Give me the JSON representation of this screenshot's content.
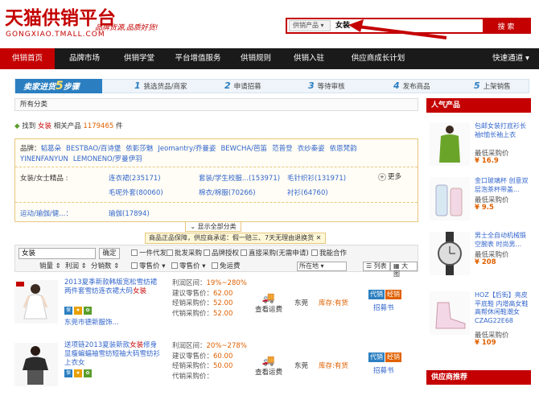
{
  "header": {
    "logo": "天猫供销平台",
    "logo_sub": "GONGXIAO.TMALL.COM",
    "slogan": "品牌货源,品质好货!"
  },
  "search": {
    "category": "供销产品 ▾",
    "keyword": "女装",
    "button": "搜 索"
  },
  "nav": {
    "items": [
      "供销首页",
      "品牌市场",
      "供销学堂",
      "平台增值服务",
      "供销规则",
      "供销入驻",
      "供应商成长计划"
    ],
    "right": "快速通道 ▾"
  },
  "steps": {
    "head_prefix": "卖家进货",
    "head_num": "5",
    "head_suffix": "步骤",
    "items": [
      {
        "n": "1",
        "t": "挑选货品/商家"
      },
      {
        "n": "2",
        "t": "申请招募"
      },
      {
        "n": "3",
        "t": "等待审核"
      },
      {
        "n": "4",
        "t": "发布商品"
      },
      {
        "n": "5",
        "t": "上架销售"
      }
    ]
  },
  "breadcrumb": "所有分类",
  "result": {
    "prefix": "找到",
    "keyword": "女装",
    "mid": "相关产品",
    "count": "1179465",
    "suffix": "件"
  },
  "filter": {
    "brand_label": "品牌：",
    "brands": [
      "韬葛朵",
      "BESTBAO/百诗堡",
      "依影莎魅",
      "Jeomantry/乔曼姿",
      "BEWCHA/芭笛",
      "范普登",
      "衣纱秦姿",
      "依恩梵韵",
      "YINENFANYUN",
      "LEMONENO/罗曼伊羽"
    ],
    "row1_label": "女装/女士精品 :",
    "row1": [
      {
        "t": "连衣裙(235171)"
      },
      {
        "t": "套装/学生校服...(153971)"
      },
      {
        "t": "毛针织衫(131971)"
      },
      {
        "t": "毛呢外套(80060)"
      },
      {
        "t": "棉衣/棉服(70266)"
      },
      {
        "t": "衬衫(64760)"
      }
    ],
    "more": "更多",
    "row2_label": "运动/瑜伽/健...：",
    "row2": [
      "瑜伽(17894)"
    ],
    "show_all": "显示全部分类"
  },
  "notice": "商品正品保障，供应商承诺：假一赔三、7天无理由退换货 ✕",
  "toolbar": {
    "input": "女装",
    "confirm": "确定",
    "checks": [
      "一件代发",
      "批发采购",
      "品牌授权",
      "直接采购(无需申请)",
      "我能合作"
    ],
    "sorts": [
      "销量 ⇕",
      "利润 ⇕",
      "分销数 ⇕"
    ],
    "checks2": [
      "零售价 ▾",
      "零售价 ▾",
      "免运费"
    ],
    "location": "所在地 ▾",
    "view_list": "列表",
    "view_big": "大图"
  },
  "products": [
    {
      "title": "2013夏季新款韩版宽松雪纺裙两件套雪纺连衣裙大码",
      "title_hl": "女装",
      "seller": "东莞市德新服饰...",
      "profit": "利润区间：",
      "profit_v": "19%~280%",
      "retail": "建议零售价：",
      "retail_v": "62.00",
      "dist": "经销采购价：",
      "dist_v": "52.00",
      "agent": "代销采购价：",
      "agent_v": "52.00",
      "ship": "查看运费",
      "city": "东莞",
      "stock": "库存:有货",
      "tag1": "代销",
      "tag2": "经销",
      "reg": "招募书"
    },
    {
      "title": "送项链2013夏装新款",
      "title_hl": "女装",
      "title_rest": "修身显瘦蝙蝠袖雪纺短袖大码雪纺衫上衣女",
      "seller": "",
      "profit": "利润区间：",
      "profit_v": "20%~278%",
      "retail": "建议零售价：",
      "retail_v": "60.00",
      "dist": "经销采购价：",
      "dist_v": "50.00",
      "agent": "代销采购价：",
      "agent_v": "",
      "ship": "查看运费",
      "city": "东莞",
      "stock": "库存:有货",
      "tag1": "代销",
      "tag2": "经销",
      "reg": "招募书"
    }
  ],
  "sidebar": {
    "title": "人气产品",
    "items": [
      {
        "name": "包邮女装打底衫长袖t恤长袖上衣",
        "price_label": "最低采购价",
        "price": "¥ 16.9"
      },
      {
        "name": "金口玻璃杯 创意双层泡茶杯带盖...",
        "price_label": "最低采购价",
        "price": "¥ 9.5"
      },
      {
        "name": "男士全自动机械锻空腕表 时尚男...",
        "price_label": "最低采购价",
        "price": "¥ 208"
      },
      {
        "name": "HOZ【后街】亮皮平底鞋 内增高女鞋 高帮休闲鞋潮女 CZAG22E68",
        "price_label": "最低采购价",
        "price": "¥ 109"
      }
    ],
    "title2": "供应商推荐"
  }
}
